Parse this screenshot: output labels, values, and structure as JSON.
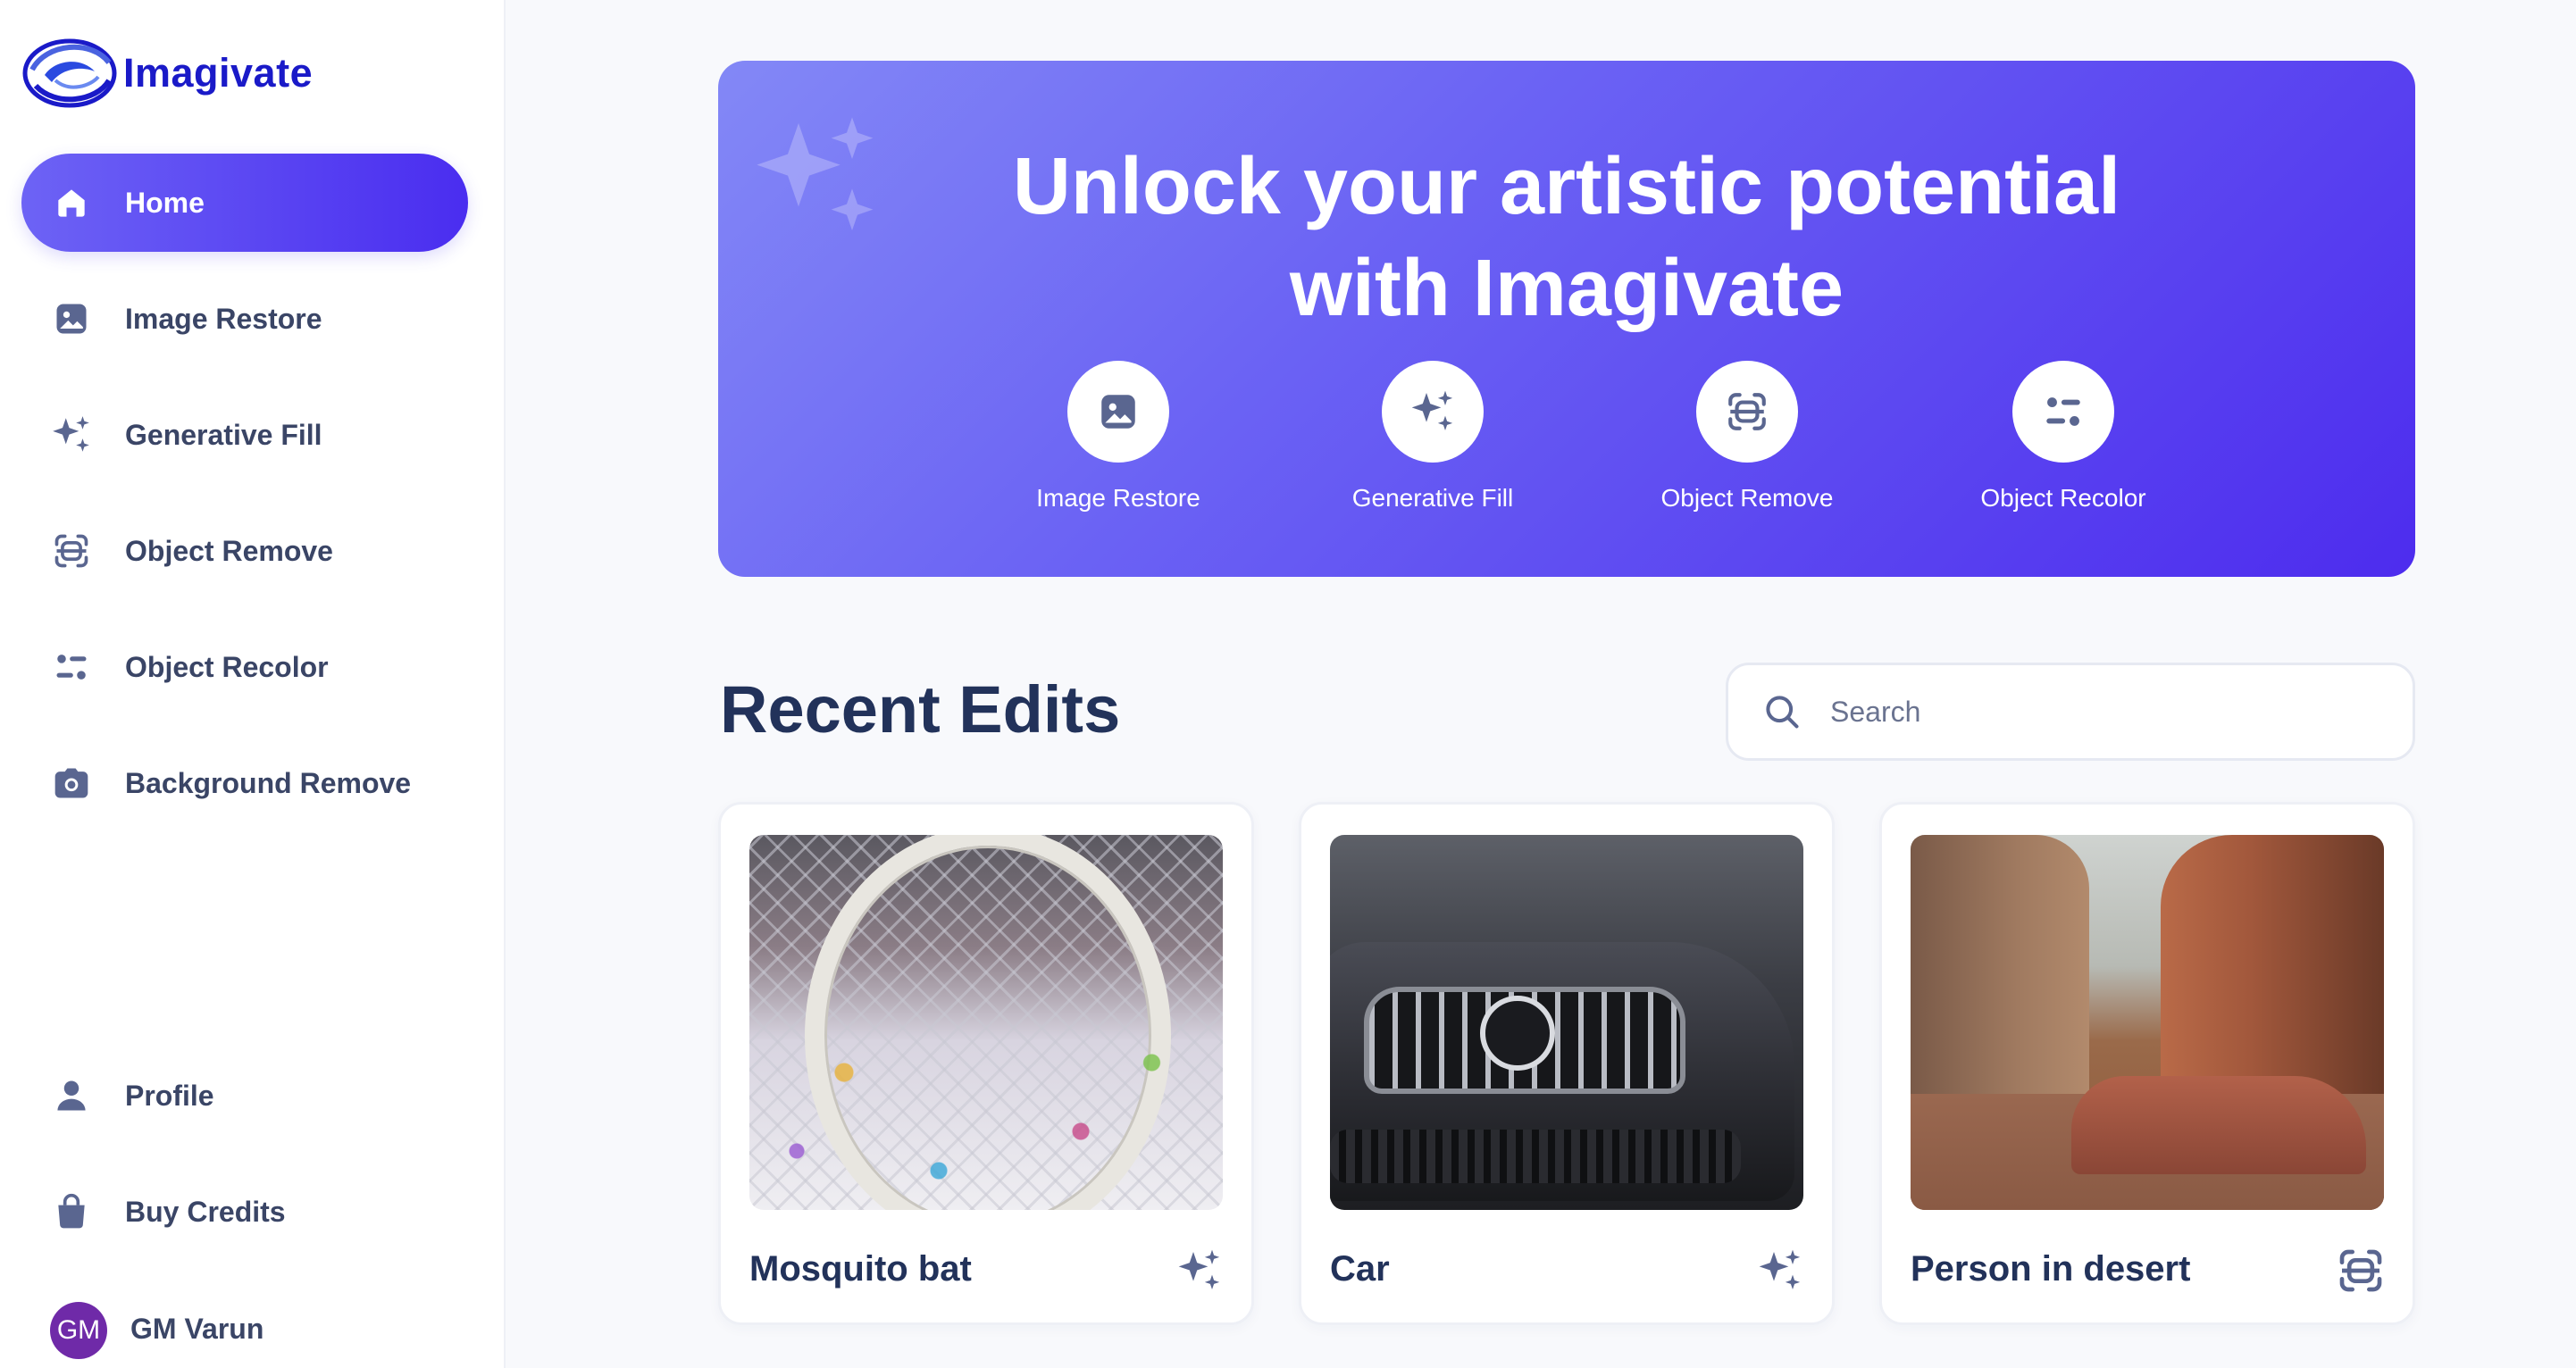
{
  "app": {
    "name": "Imagivate",
    "accent": "#4f2ff0",
    "logo_color": "#1a1ac8"
  },
  "sidebar": {
    "items": [
      {
        "label": "Home",
        "icon": "home-icon",
        "active": true
      },
      {
        "label": "Image Restore",
        "icon": "image-icon",
        "active": false
      },
      {
        "label": "Generative Fill",
        "icon": "sparkles-icon",
        "active": false
      },
      {
        "label": "Object Remove",
        "icon": "object-scan-icon",
        "active": false
      },
      {
        "label": "Object Recolor",
        "icon": "recolor-icon",
        "active": false
      },
      {
        "label": "Background Remove",
        "icon": "camera-icon",
        "active": false
      }
    ],
    "bottom_items": [
      {
        "label": "Profile",
        "icon": "user-icon"
      },
      {
        "label": "Buy Credits",
        "icon": "shopping-bag-icon"
      }
    ],
    "user": {
      "initials": "GM",
      "name": "GM Varun",
      "avatar_color": "#6f2aa8"
    }
  },
  "hero": {
    "title_line1": "Unlock your artistic potential",
    "title_line2": "with Imagivate",
    "features": [
      {
        "label": "Image Restore",
        "icon": "image-icon"
      },
      {
        "label": "Generative Fill",
        "icon": "sparkles-icon"
      },
      {
        "label": "Object Remove",
        "icon": "object-scan-icon"
      },
      {
        "label": "Object Recolor",
        "icon": "recolor-icon"
      }
    ]
  },
  "recent": {
    "title": "Recent Edits",
    "search_placeholder": "Search",
    "search_value": "",
    "cards": [
      {
        "title": "Mosquito bat",
        "icon": "sparkles-icon"
      },
      {
        "title": "Car",
        "icon": "sparkles-icon"
      },
      {
        "title": "Person in desert",
        "icon": "object-scan-icon"
      }
    ]
  }
}
